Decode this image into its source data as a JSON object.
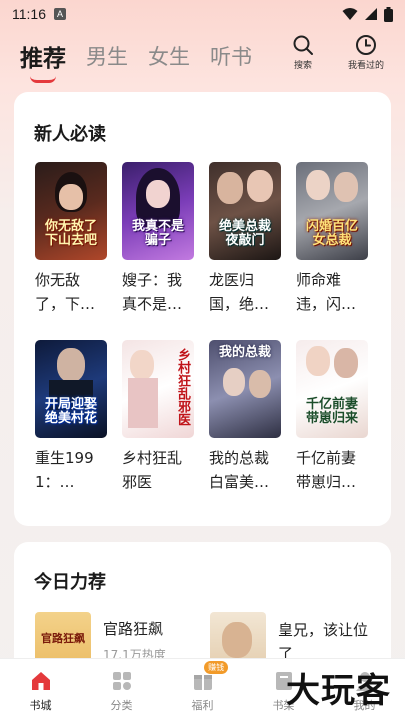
{
  "status_bar": {
    "time": "11:16",
    "indicator": "A"
  },
  "top_nav": {
    "tabs": [
      {
        "label": "推荐",
        "active": true
      },
      {
        "label": "男生",
        "active": false
      },
      {
        "label": "女生",
        "active": false
      },
      {
        "label": "听书",
        "active": false
      }
    ],
    "search_label": "搜索",
    "history_label": "我看过的"
  },
  "new_reader": {
    "title": "新人必读",
    "books": [
      {
        "title": "你无敌了，下…",
        "cover_text": "你无敌了下山去吧"
      },
      {
        "title": "嫂子：我真不是…",
        "cover_text": "我真不是骗子"
      },
      {
        "title": "龙医归国，绝…",
        "cover_text": "绝美总裁夜敲门"
      },
      {
        "title": "师命难违，闪…",
        "cover_text": "闪婚百亿女总裁"
      },
      {
        "title": "重生1991：…",
        "cover_text": "开局迎娶绝美村花"
      },
      {
        "title": "乡村狂乱邪医",
        "cover_text": "乡村狂乱邪医"
      },
      {
        "title": "我的总裁白富美…",
        "cover_text": "我的总裁"
      },
      {
        "title": "千亿前妻带崽归…",
        "cover_text": "千亿前妻带崽归来"
      }
    ]
  },
  "today_rec": {
    "title": "今日力荐",
    "items": [
      {
        "title": "官路狂飙",
        "sub": "17.1万热度",
        "cover_text": "官路狂飙"
      },
      {
        "title": "皇兄，该让位了",
        "sub": "",
        "cover_text": ""
      }
    ]
  },
  "bottom_nav": {
    "items": [
      {
        "label": "书城",
        "active": true
      },
      {
        "label": "分类",
        "active": false
      },
      {
        "label": "福利",
        "active": false,
        "badge": "赚钱"
      },
      {
        "label": "书架",
        "active": false
      },
      {
        "label": "我的",
        "active": false
      }
    ]
  },
  "watermark": "大玩客",
  "colors": {
    "accent": "#e4393c",
    "badge": "#f29b2a"
  }
}
